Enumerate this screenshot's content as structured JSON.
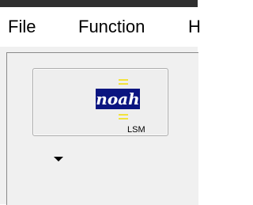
{
  "menubar": {
    "items": [
      {
        "label": "File"
      },
      {
        "label": "Function"
      },
      {
        "label": "H"
      }
    ]
  },
  "noah_button": {
    "logo_text": "noah",
    "logo_subtext": "LSM",
    "colors": {
      "logo_box": "#0b1580",
      "logo_bars": "#f2e23a"
    }
  },
  "dropdown": {
    "icon": "triangle-down-icon"
  }
}
